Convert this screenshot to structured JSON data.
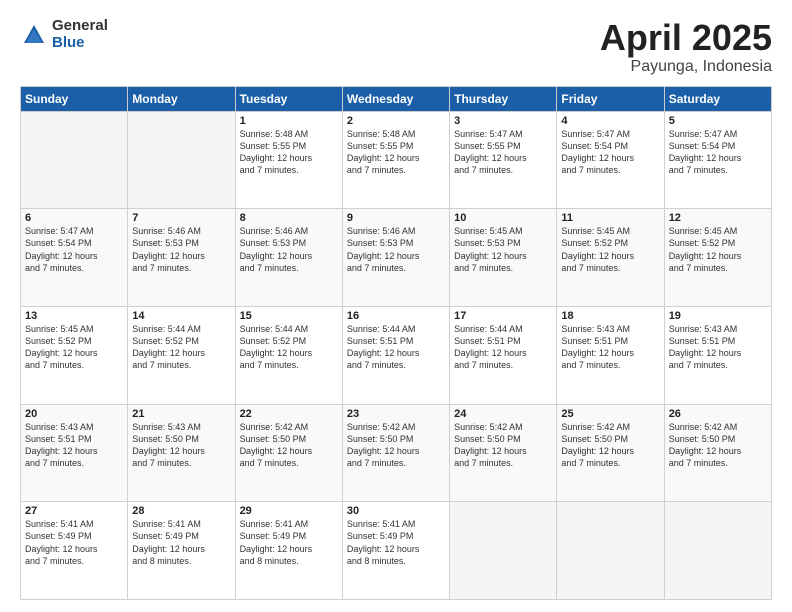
{
  "logo": {
    "general": "General",
    "blue": "Blue"
  },
  "title": "April 2025",
  "subtitle": "Payunga, Indonesia",
  "headers": [
    "Sunday",
    "Monday",
    "Tuesday",
    "Wednesday",
    "Thursday",
    "Friday",
    "Saturday"
  ],
  "weeks": [
    [
      {
        "day": "",
        "info": ""
      },
      {
        "day": "",
        "info": ""
      },
      {
        "day": "1",
        "info": "Sunrise: 5:48 AM\nSunset: 5:55 PM\nDaylight: 12 hours\nand 7 minutes."
      },
      {
        "day": "2",
        "info": "Sunrise: 5:48 AM\nSunset: 5:55 PM\nDaylight: 12 hours\nand 7 minutes."
      },
      {
        "day": "3",
        "info": "Sunrise: 5:47 AM\nSunset: 5:55 PM\nDaylight: 12 hours\nand 7 minutes."
      },
      {
        "day": "4",
        "info": "Sunrise: 5:47 AM\nSunset: 5:54 PM\nDaylight: 12 hours\nand 7 minutes."
      },
      {
        "day": "5",
        "info": "Sunrise: 5:47 AM\nSunset: 5:54 PM\nDaylight: 12 hours\nand 7 minutes."
      }
    ],
    [
      {
        "day": "6",
        "info": "Sunrise: 5:47 AM\nSunset: 5:54 PM\nDaylight: 12 hours\nand 7 minutes."
      },
      {
        "day": "7",
        "info": "Sunrise: 5:46 AM\nSunset: 5:53 PM\nDaylight: 12 hours\nand 7 minutes."
      },
      {
        "day": "8",
        "info": "Sunrise: 5:46 AM\nSunset: 5:53 PM\nDaylight: 12 hours\nand 7 minutes."
      },
      {
        "day": "9",
        "info": "Sunrise: 5:46 AM\nSunset: 5:53 PM\nDaylight: 12 hours\nand 7 minutes."
      },
      {
        "day": "10",
        "info": "Sunrise: 5:45 AM\nSunset: 5:53 PM\nDaylight: 12 hours\nand 7 minutes."
      },
      {
        "day": "11",
        "info": "Sunrise: 5:45 AM\nSunset: 5:52 PM\nDaylight: 12 hours\nand 7 minutes."
      },
      {
        "day": "12",
        "info": "Sunrise: 5:45 AM\nSunset: 5:52 PM\nDaylight: 12 hours\nand 7 minutes."
      }
    ],
    [
      {
        "day": "13",
        "info": "Sunrise: 5:45 AM\nSunset: 5:52 PM\nDaylight: 12 hours\nand 7 minutes."
      },
      {
        "day": "14",
        "info": "Sunrise: 5:44 AM\nSunset: 5:52 PM\nDaylight: 12 hours\nand 7 minutes."
      },
      {
        "day": "15",
        "info": "Sunrise: 5:44 AM\nSunset: 5:52 PM\nDaylight: 12 hours\nand 7 minutes."
      },
      {
        "day": "16",
        "info": "Sunrise: 5:44 AM\nSunset: 5:51 PM\nDaylight: 12 hours\nand 7 minutes."
      },
      {
        "day": "17",
        "info": "Sunrise: 5:44 AM\nSunset: 5:51 PM\nDaylight: 12 hours\nand 7 minutes."
      },
      {
        "day": "18",
        "info": "Sunrise: 5:43 AM\nSunset: 5:51 PM\nDaylight: 12 hours\nand 7 minutes."
      },
      {
        "day": "19",
        "info": "Sunrise: 5:43 AM\nSunset: 5:51 PM\nDaylight: 12 hours\nand 7 minutes."
      }
    ],
    [
      {
        "day": "20",
        "info": "Sunrise: 5:43 AM\nSunset: 5:51 PM\nDaylight: 12 hours\nand 7 minutes."
      },
      {
        "day": "21",
        "info": "Sunrise: 5:43 AM\nSunset: 5:50 PM\nDaylight: 12 hours\nand 7 minutes."
      },
      {
        "day": "22",
        "info": "Sunrise: 5:42 AM\nSunset: 5:50 PM\nDaylight: 12 hours\nand 7 minutes."
      },
      {
        "day": "23",
        "info": "Sunrise: 5:42 AM\nSunset: 5:50 PM\nDaylight: 12 hours\nand 7 minutes."
      },
      {
        "day": "24",
        "info": "Sunrise: 5:42 AM\nSunset: 5:50 PM\nDaylight: 12 hours\nand 7 minutes."
      },
      {
        "day": "25",
        "info": "Sunrise: 5:42 AM\nSunset: 5:50 PM\nDaylight: 12 hours\nand 7 minutes."
      },
      {
        "day": "26",
        "info": "Sunrise: 5:42 AM\nSunset: 5:50 PM\nDaylight: 12 hours\nand 7 minutes."
      }
    ],
    [
      {
        "day": "27",
        "info": "Sunrise: 5:41 AM\nSunset: 5:49 PM\nDaylight: 12 hours\nand 7 minutes."
      },
      {
        "day": "28",
        "info": "Sunrise: 5:41 AM\nSunset: 5:49 PM\nDaylight: 12 hours\nand 8 minutes."
      },
      {
        "day": "29",
        "info": "Sunrise: 5:41 AM\nSunset: 5:49 PM\nDaylight: 12 hours\nand 8 minutes."
      },
      {
        "day": "30",
        "info": "Sunrise: 5:41 AM\nSunset: 5:49 PM\nDaylight: 12 hours\nand 8 minutes."
      },
      {
        "day": "",
        "info": ""
      },
      {
        "day": "",
        "info": ""
      },
      {
        "day": "",
        "info": ""
      }
    ]
  ]
}
